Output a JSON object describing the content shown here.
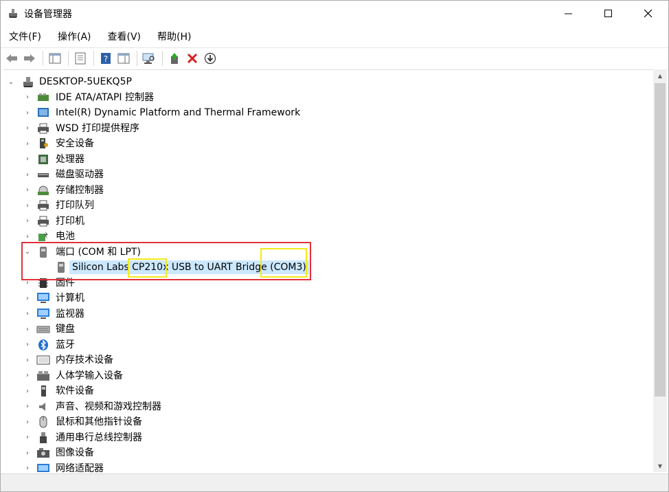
{
  "title": "设备管理器",
  "menu": [
    "文件(F)",
    "操作(A)",
    "查看(V)",
    "帮助(H)"
  ],
  "tree": {
    "root": "DESKTOP-5UEKQ5P",
    "categories": [
      {
        "label": "IDE ATA/ATAPI 控制器",
        "icon": "ide-controller-icon"
      },
      {
        "label": "Intel(R) Dynamic Platform and Thermal Framework",
        "icon": "thermal-framework-icon"
      },
      {
        "label": "WSD 打印提供程序",
        "icon": "printer-provider-icon"
      },
      {
        "label": "安全设备",
        "icon": "security-device-icon"
      },
      {
        "label": "处理器",
        "icon": "processor-icon"
      },
      {
        "label": "磁盘驱动器",
        "icon": "disk-drive-icon"
      },
      {
        "label": "存储控制器",
        "icon": "storage-controller-icon"
      },
      {
        "label": "打印队列",
        "icon": "print-queue-icon"
      },
      {
        "label": "打印机",
        "icon": "printer-icon"
      },
      {
        "label": "电池",
        "icon": "battery-icon"
      }
    ],
    "ports": {
      "label": "端口 (COM 和 LPT)",
      "device": "Silicon Labs CP210x USB to UART Bridge (COM3)"
    },
    "categories_after": [
      {
        "label": "固件",
        "icon": "firmware-icon"
      },
      {
        "label": "计算机",
        "icon": "computer-icon"
      },
      {
        "label": "监视器",
        "icon": "monitor-icon"
      },
      {
        "label": "键盘",
        "icon": "keyboard-icon"
      },
      {
        "label": "蓝牙",
        "icon": "bluetooth-icon"
      },
      {
        "label": "内存技术设备",
        "icon": "memory-technology-icon"
      },
      {
        "label": "人体学输入设备",
        "icon": "hid-icon"
      },
      {
        "label": "软件设备",
        "icon": "software-device-icon"
      },
      {
        "label": "声音、视频和游戏控制器",
        "icon": "sound-icon"
      },
      {
        "label": "鼠标和其他指针设备",
        "icon": "mouse-icon"
      },
      {
        "label": "通用串行总线控制器",
        "icon": "usb-icon"
      },
      {
        "label": "图像设备",
        "icon": "imaging-icon"
      },
      {
        "label": "网络适配器",
        "icon": "network-adapter-icon"
      }
    ]
  },
  "colors": {
    "highlight": "#cce8ff",
    "red_annotation": "#e0303a",
    "yellow_annotation": "#f2ea1a"
  }
}
